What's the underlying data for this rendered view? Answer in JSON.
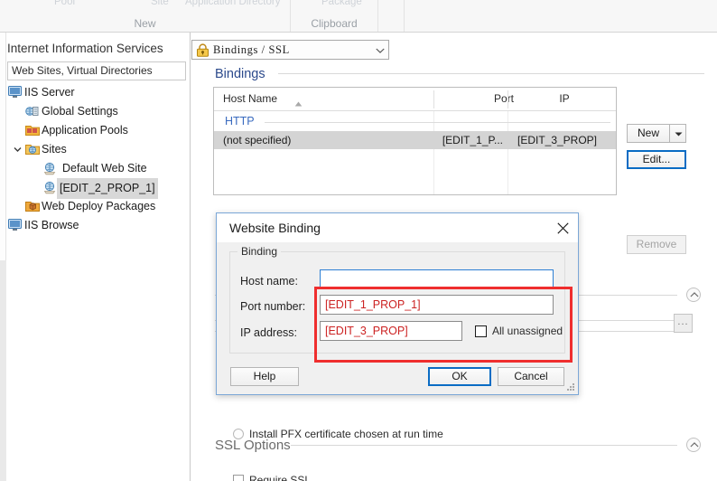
{
  "ribbon": {
    "top_labels": [
      "Pool",
      "Site",
      "Application Directory",
      "Package"
    ],
    "groups": [
      "New",
      "Clipboard",
      "",
      ""
    ]
  },
  "sidebar": {
    "header": "Internet Information Services",
    "filter_value": "Web Sites, Virtual Directories",
    "tree": [
      {
        "label": "IIS Server",
        "icon": "monitor-icon",
        "indent": 0,
        "twisty": "none",
        "selected": false
      },
      {
        "label": "Global Settings",
        "icon": "globe-settings-icon",
        "indent": 1,
        "twisty": "none",
        "selected": false
      },
      {
        "label": "Application Pools",
        "icon": "app-pools-icon",
        "indent": 1,
        "twisty": "none",
        "selected": false
      },
      {
        "label": "Sites",
        "icon": "sites-folder-icon",
        "indent": 1,
        "twisty": "expanded",
        "selected": false
      },
      {
        "label": "Default Web Site",
        "icon": "website-icon",
        "indent": 2,
        "twisty": "none",
        "selected": false
      },
      {
        "label": "[EDIT_2_PROP_1]",
        "icon": "website-icon",
        "indent": 2,
        "twisty": "none",
        "selected": true
      },
      {
        "label": "Web Deploy Packages",
        "icon": "package-folder-icon",
        "indent": 1,
        "twisty": "none",
        "selected": false
      },
      {
        "label": "IIS Browse",
        "icon": "monitor-icon",
        "indent": 0,
        "twisty": "none",
        "selected": false
      }
    ]
  },
  "main": {
    "combo": {
      "value": "Bindings / SSL",
      "icon": "lock-icon"
    },
    "bindings_section": {
      "title": "Bindings"
    },
    "table": {
      "columns": [
        "Host Name",
        "Port",
        "IP"
      ],
      "sort_column": "Host Name",
      "sort_direction": "ascending",
      "group_label": "HTTP",
      "rows": [
        {
          "host": "(not specified)",
          "port": "[EDIT_1_P...",
          "ip": "[EDIT_3_PROP]",
          "selected": true
        }
      ]
    },
    "buttons": {
      "new": "New",
      "edit": "Edit...",
      "remove": "Remove",
      "browse": "..."
    },
    "pfx_radio": "Install PFX certificate chosen at run time",
    "ssl_options_section": {
      "title": "SSL Options"
    },
    "require_ssl": "Require SSL"
  },
  "dialog": {
    "title": "Website Binding",
    "group_legend": "Binding",
    "fields": [
      {
        "label": "Host name:",
        "value": "",
        "focused": true
      },
      {
        "label": "Port number:",
        "value": "[EDIT_1_PROP_1]",
        "focused": false
      },
      {
        "label": "IP address:",
        "value": "[EDIT_3_PROP]",
        "focused": false
      }
    ],
    "all_unassigned": "All unassigned",
    "help": "Help",
    "ok": "OK",
    "cancel": "Cancel"
  },
  "colors": {
    "accent_blue": "#2c4a8c",
    "focus_blue": "#0a6cc4",
    "highlight_red": "#ef2e2e",
    "value_red": "#cc2222",
    "group_link": "#3a6bbf"
  }
}
